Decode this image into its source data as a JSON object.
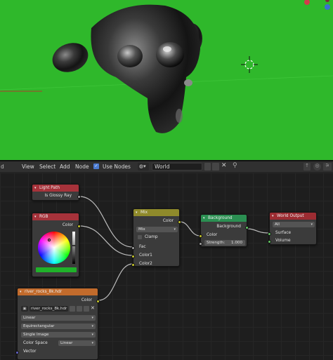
{
  "header": {
    "view": "View",
    "select": "Select",
    "add": "Add",
    "node": "Node",
    "use_nodes": "Use Nodes",
    "world_name": "World"
  },
  "nodes": {
    "light_path": {
      "title": "Light Path",
      "output": "Is Glossy Ray"
    },
    "rgb": {
      "title": "RGB",
      "output": "Color",
      "swatch_color": "#1fb22a"
    },
    "mix": {
      "title": "Mix",
      "output": "Color",
      "blend": "Mix",
      "clamp": "Clamp",
      "fac": "Fac",
      "color1": "Color1",
      "color2": "Color2"
    },
    "background": {
      "title": "Background",
      "output": "Background",
      "color": "Color",
      "strength_label": "Strength:",
      "strength_value": "1.000"
    },
    "world_output": {
      "title": "World Output",
      "target": "All",
      "surface": "Surface",
      "volume": "Volume"
    },
    "env_texture": {
      "title": "river_rocks_8k.hdr",
      "output": "Color",
      "image_name": "river_rocks_8k.hdr",
      "interpolation": "Linear",
      "projection": "Equirectangular",
      "source": "Single Image",
      "color_space_label": "Color Space",
      "color_space": "Linear",
      "vector": "Vector"
    }
  },
  "colors": {
    "viewport_bg": "#2fb82b",
    "input_header": "#a6323a",
    "color_header": "#c26b2c",
    "converter_header": "#8f8a2b",
    "shader_header": "#2b8f52",
    "output_header": "#9c2c32"
  }
}
